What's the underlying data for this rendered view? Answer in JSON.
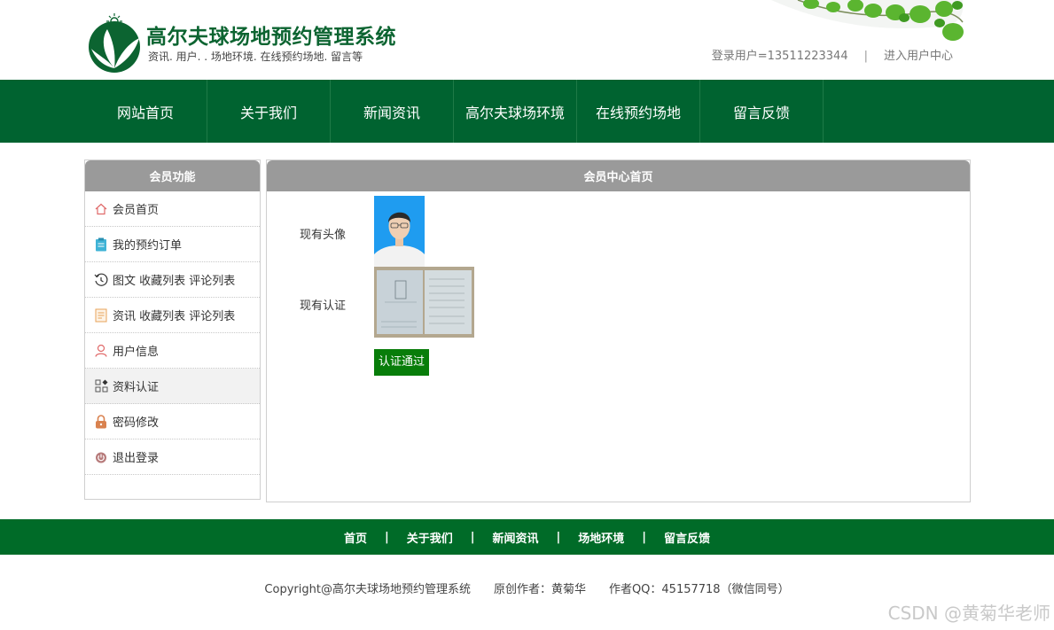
{
  "site": {
    "title": "高尔夫球场地预约管理系统",
    "subtitle": "资讯. 用户. . 场地环境. 在线预约场地. 留言等"
  },
  "userbar": {
    "login_user": "登录用户=13511223344",
    "separator": "|",
    "user_center": "进入用户中心"
  },
  "nav": [
    {
      "label": "网站首页"
    },
    {
      "label": "关于我们"
    },
    {
      "label": "新闻资讯"
    },
    {
      "label": "高尔夫球场环境"
    },
    {
      "label": "在线预约场地"
    },
    {
      "label": "留言反馈"
    }
  ],
  "sidebar": {
    "title": "会员功能",
    "items": [
      {
        "label": "会员首页",
        "icon": "home-icon"
      },
      {
        "label": "我的预约订单",
        "icon": "clipboard-icon"
      },
      {
        "label": "图文 收藏列表 评论列表",
        "icon": "history-icon"
      },
      {
        "label": "资讯 收藏列表 评论列表",
        "icon": "document-icon"
      },
      {
        "label": "用户信息",
        "icon": "user-icon"
      },
      {
        "label": "资料认证",
        "icon": "grid-icon",
        "active": true
      },
      {
        "label": "密码修改",
        "icon": "lock-icon"
      },
      {
        "label": "退出登录",
        "icon": "power-icon"
      }
    ]
  },
  "main": {
    "title": "会员中心首页",
    "avatar_label": "现有头像",
    "cert_label": "现有认证",
    "verify_button": "认证通过"
  },
  "footer": {
    "links": [
      "首页",
      "关于我们",
      "新闻资讯",
      "场地环境",
      "留言反馈"
    ],
    "separator": "|",
    "copyright": "Copyright@高尔夫球场地预约管理系统　　原创作者：黄菊华　　作者QQ：45157718（微信同号）"
  },
  "watermark": "CSDN @黄菊华老师",
  "colors": {
    "nav_bg": "#006330",
    "footer_bg": "#006b28",
    "panel_head": "#9a9a9a",
    "button": "#087d0a",
    "title_green": "#0c6431"
  }
}
